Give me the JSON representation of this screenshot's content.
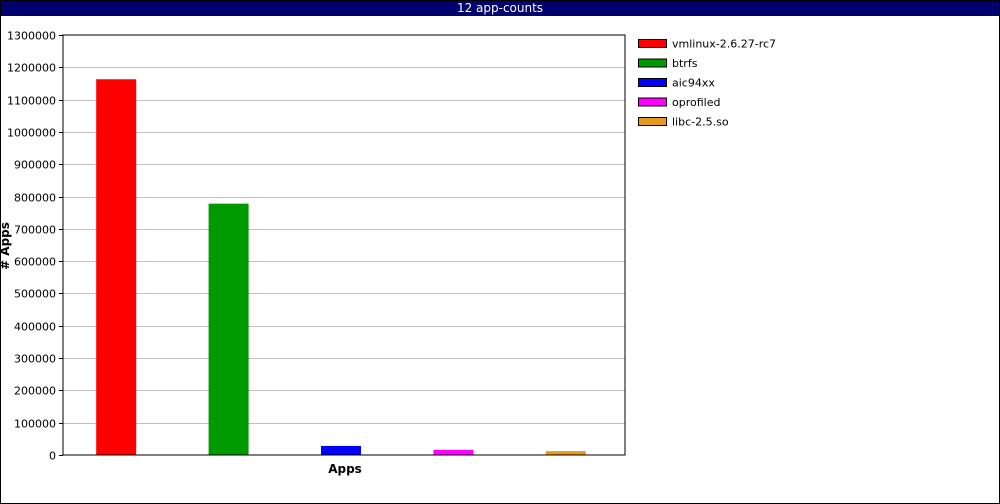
{
  "window": {
    "title": "12 app-counts"
  },
  "chart_data": {
    "type": "bar",
    "title": "12 app-counts",
    "xlabel": "Apps",
    "ylabel": "# Apps",
    "ylim": [
      0,
      1300000
    ],
    "yticks": [
      0,
      100000,
      200000,
      300000,
      400000,
      500000,
      600000,
      700000,
      800000,
      900000,
      1000000,
      1100000,
      1200000,
      1300000
    ],
    "grid": true,
    "legend_position": "right",
    "series": [
      {
        "name": "vmlinux-2.6.27-rc7",
        "value": 1163000,
        "color": "#ff0000"
      },
      {
        "name": "btrfs",
        "value": 778000,
        "color": "#009900"
      },
      {
        "name": "aic94xx",
        "value": 28000,
        "color": "#0000ff"
      },
      {
        "name": "oprofiled",
        "value": 16000,
        "color": "#ff00ff"
      },
      {
        "name": "libc-2.5.so",
        "value": 12000,
        "color": "#e59a1c"
      }
    ]
  }
}
